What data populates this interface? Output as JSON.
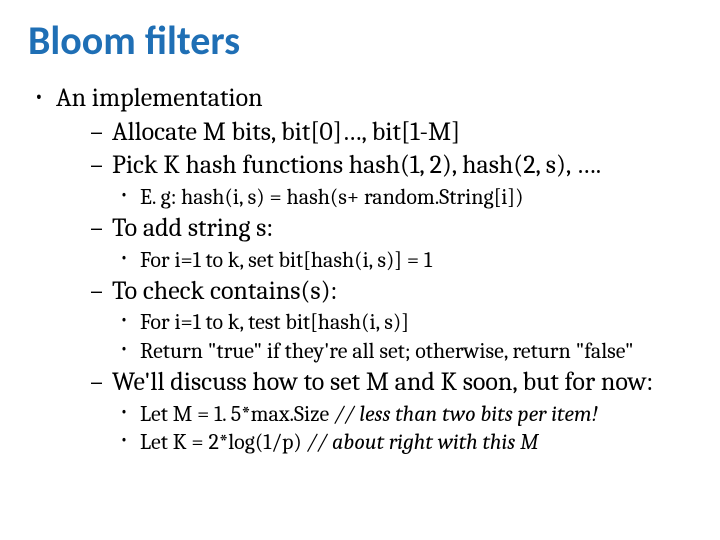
{
  "title": "Bloom filters",
  "l1": {
    "impl": "An implementation"
  },
  "l2": {
    "allocate": "Allocate M bits, bit[0]…, bit[1-M]",
    "pick": "Pick K hash functions hash(1, 2), hash(2, s), ….",
    "add": "To add string s:",
    "check": "To check contains(s):",
    "discuss": "We'll discuss how to set M and K soon, but for now:"
  },
  "l3": {
    "eg": "E. g: hash(i, s) = hash(s+ random.String[i])",
    "addFor": "For i=1 to k, set bit[hash(i, s)] = 1",
    "checkFor": "For i=1 to k, test bit[hash(i, s)]",
    "checkReturn": "Return \"true\" if they're all set; otherwise, return \"false\"",
    "letM_prefix": "Let M = 1. 5*max.Size  ",
    "letM_comment": "// less than two bits per item!",
    "letK_prefix": "Let K = 2*log(1/p)      ",
    "letK_comment": "// about right with this M"
  }
}
